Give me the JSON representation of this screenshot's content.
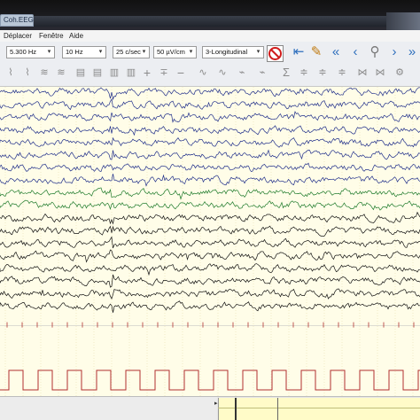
{
  "window": {
    "title": "Coh.EEG"
  },
  "menu": {
    "items": [
      "Déplacer",
      "Fenêtre",
      "Aide"
    ]
  },
  "toolbar": {
    "filter_low": "5.300 Hz",
    "filter_high": "10 Hz",
    "timebase": "25 c/sec",
    "sensitivity": "50 µV/cm",
    "montage": "3-Longitudinal",
    "nav_icons": [
      "first-icon",
      "bookmark-icon",
      "double-left-icon",
      "left-icon",
      "zoom-icon",
      "right-icon",
      "double-right-icon"
    ]
  },
  "eeg": {
    "channel_count": 20,
    "channel_colors": [
      "#1f2e8a",
      "#1f2e8a",
      "#1f2e8a",
      "#1f2e8a",
      "#1f2e8a",
      "#1f2e8a",
      "#1f2e8a",
      "#1f2e8a",
      "#1d7a2a",
      "#1d7a2a",
      "#111111",
      "#111111",
      "#111111",
      "#111111",
      "#111111",
      "#111111",
      "#111111",
      "#111111",
      "#b03030",
      "#b03030"
    ],
    "background": "#fffde8",
    "grid_color": "#e9dfb0",
    "marker_channel_color": "#b03030"
  }
}
